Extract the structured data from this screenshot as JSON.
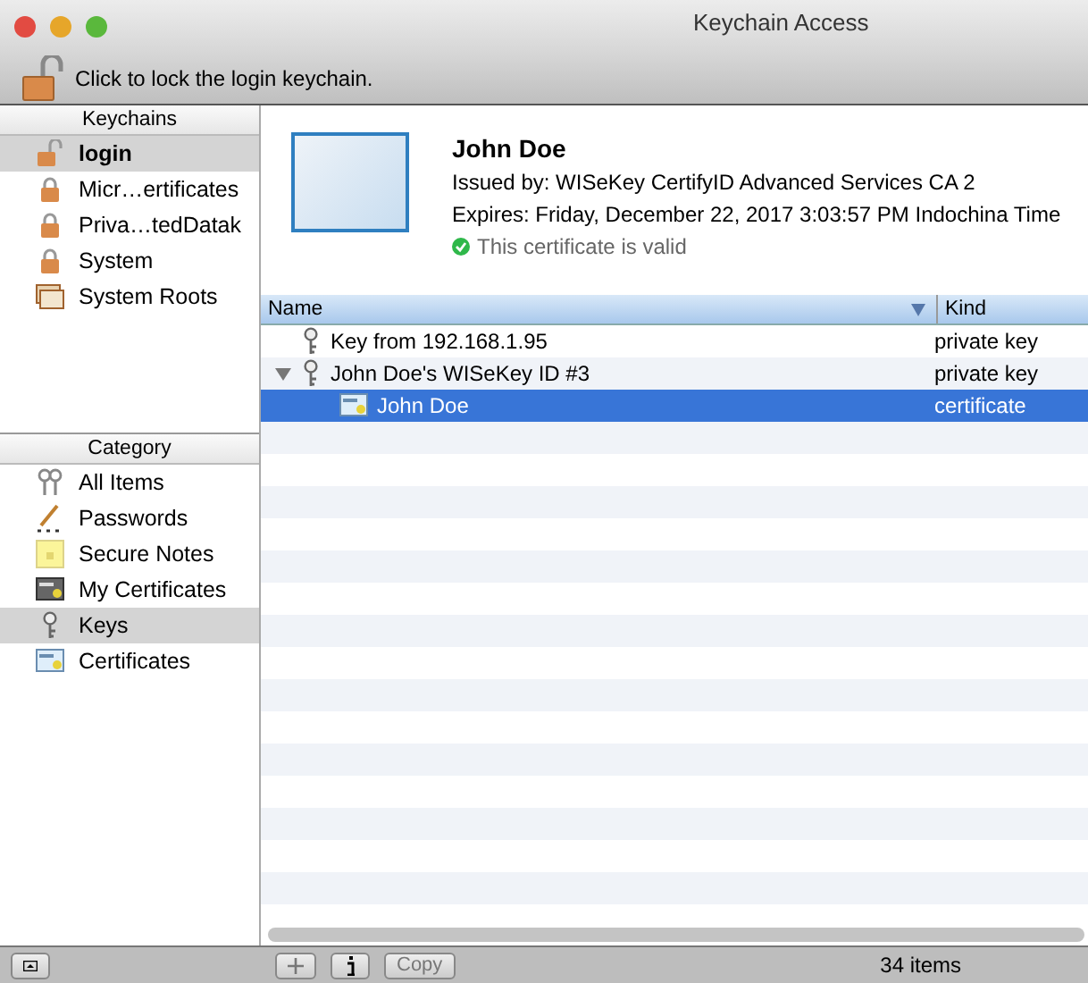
{
  "window": {
    "title": "Keychain Access"
  },
  "toolbar": {
    "lock_text": "Click to lock the login keychain."
  },
  "keychains": {
    "header": "Keychains",
    "items": [
      {
        "label": "login",
        "kind": "unlocked",
        "selected": true
      },
      {
        "label": "Micr…ertificates",
        "kind": "locked",
        "selected": false
      },
      {
        "label": "Priva…tedDatak",
        "kind": "locked",
        "selected": false
      },
      {
        "label": "System",
        "kind": "locked",
        "selected": false
      },
      {
        "label": "System Roots",
        "kind": "roots",
        "selected": false
      }
    ]
  },
  "category": {
    "header": "Category",
    "items": [
      {
        "label": "All Items",
        "kind": "keys",
        "selected": false
      },
      {
        "label": "Passwords",
        "kind": "pencil",
        "selected": false
      },
      {
        "label": "Secure Notes",
        "kind": "note",
        "selected": false
      },
      {
        "label": "My Certificates",
        "kind": "mycert",
        "selected": false
      },
      {
        "label": "Keys",
        "kind": "key",
        "selected": true
      },
      {
        "label": "Certificates",
        "kind": "cert",
        "selected": false
      }
    ]
  },
  "detail": {
    "name": "John Doe",
    "issued_by": "Issued by: WISeKey CertifyID Advanced Services CA 2",
    "expires": "Expires: Friday, December 22, 2017 3:03:57 PM Indochina Time",
    "status": "This certificate is valid",
    "valid": true
  },
  "table": {
    "columns": [
      "Name",
      "Kind"
    ],
    "rows": [
      {
        "name": "Key from 192.168.1.95",
        "kind_text": "private key",
        "kind": "key",
        "selected": false
      },
      {
        "name": "John Doe's WISeKey ID #3",
        "kind_text": "private key",
        "kind": "key",
        "expanded": true,
        "selected": false,
        "children": [
          {
            "name": "John Doe",
            "kind_text": "certificate",
            "kind": "cert",
            "selected": true
          }
        ]
      }
    ]
  },
  "bottom_bar": {
    "buttons": [
      "Copy"
    ],
    "count": "34 items"
  }
}
